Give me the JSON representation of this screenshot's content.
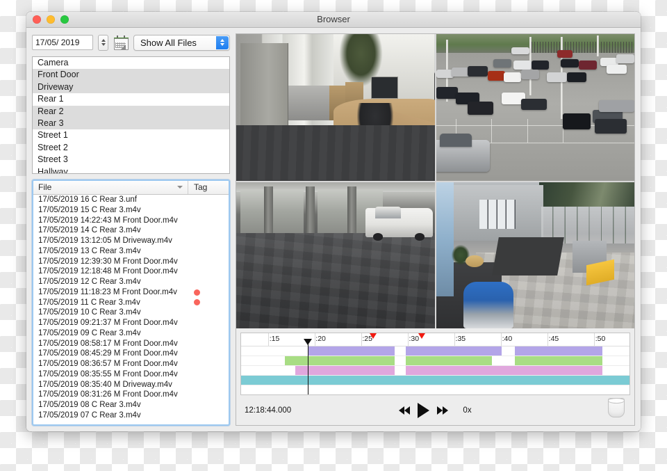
{
  "window": {
    "title": "Browser",
    "traffic_lights": [
      "close",
      "minimize",
      "zoom"
    ]
  },
  "toolbar": {
    "date_value": "17/05/ 2019",
    "calendar_icon": "calendar-icon",
    "stepper_icon": "stepper-updown-icon",
    "filter_selected": "Show All Files",
    "filter_options": [
      "Show All Files"
    ]
  },
  "camera_list": {
    "header": "Camera",
    "items": [
      "Front Door",
      "Driveway",
      "Rear 1",
      "Rear 2",
      "Rear 3",
      "Street 1",
      "Street 2",
      "Street 3",
      "Hallway"
    ]
  },
  "file_list": {
    "columns": {
      "file": "File",
      "tag": "Tag"
    },
    "sort_icon": "chevron-down-icon",
    "rows": [
      {
        "name": "17/05/2019 16 C Rear 3.unf",
        "tag": ""
      },
      {
        "name": "17/05/2019 15 C Rear 3.m4v",
        "tag": ""
      },
      {
        "name": "17/05/2019 14:22:43 M Front Door.m4v",
        "tag": ""
      },
      {
        "name": "17/05/2019 14 C Rear 3.m4v",
        "tag": ""
      },
      {
        "name": "17/05/2019 13:12:05 M Driveway.m4v",
        "tag": ""
      },
      {
        "name": "17/05/2019 13 C Rear 3.m4v",
        "tag": ""
      },
      {
        "name": "17/05/2019 12:39:30 M Front Door.m4v",
        "tag": ""
      },
      {
        "name": "17/05/2019 12:18:48 M Front Door.m4v",
        "tag": ""
      },
      {
        "name": "17/05/2019 12 C Rear 3.m4v",
        "tag": ""
      },
      {
        "name": "17/05/2019 11:18:23 M Front Door.m4v",
        "tag": "red"
      },
      {
        "name": "17/05/2019 11 C Rear 3.m4v",
        "tag": "red"
      },
      {
        "name": "17/05/2019 10 C Rear 3.m4v",
        "tag": ""
      },
      {
        "name": "17/05/2019 09:21:37 M Front Door.m4v",
        "tag": ""
      },
      {
        "name": "17/05/2019 09 C Rear 3.m4v",
        "tag": ""
      },
      {
        "name": "17/05/2019 08:58:17 M Front Door.m4v",
        "tag": ""
      },
      {
        "name": "17/05/2019 08:45:29 M Front Door.m4v",
        "tag": ""
      },
      {
        "name": "17/05/2019 08:36:57 M Front Door.m4v",
        "tag": ""
      },
      {
        "name": "17/05/2019 08:35:55 M Front Door.m4v",
        "tag": ""
      },
      {
        "name": "17/05/2019 08:35:40 M Driveway.m4v",
        "tag": ""
      },
      {
        "name": "17/05/2019 08:31:26 M Front Door.m4v",
        "tag": ""
      },
      {
        "name": "17/05/2019 08 C Rear 3.m4v",
        "tag": ""
      },
      {
        "name": "17/05/2019 07 C Rear 3.m4v",
        "tag": ""
      }
    ],
    "tag_color": "#f9655c"
  },
  "video_grid": {
    "cells": [
      {
        "id": "cell-office",
        "scene": "office interior with glass entry doors, potted plant, desk with monitor, chairs and dark carpet"
      },
      {
        "id": "cell-lot",
        "scene": "aerial view of dealership parking lot full of cars, light poles, grass and fence at rear"
      },
      {
        "id": "cell-bay",
        "scene": "service bay garage with open doors, tiled floor and a white pickup truck"
      },
      {
        "id": "cell-showroom",
        "scene": "dealership showroom with blue car, yellow desk, tiled floor and landscape banner"
      }
    ]
  },
  "timeline": {
    "ruler_labels": [
      ":15",
      ":20",
      ":25",
      ":30",
      ":35",
      ":40",
      ":45",
      ":50"
    ],
    "ruler_positions_pct": [
      7.0,
      18.9,
      30.9,
      42.9,
      54.9,
      66.9,
      78.9,
      90.9
    ],
    "playhead_pct": 17.1,
    "red_markers_pct": [
      34.0,
      46.5
    ],
    "tracks": [
      {
        "name": "track-purple",
        "color": "#b3a5e8",
        "segments": [
          {
            "start_pct": 17.1,
            "end_pct": 39.6
          },
          {
            "start_pct": 42.4,
            "end_pct": 67.0
          },
          {
            "start_pct": 70.4,
            "end_pct": 93.1
          }
        ]
      },
      {
        "name": "track-green",
        "color": "#a8dd84",
        "segments": [
          {
            "start_pct": 11.2,
            "end_pct": 39.6
          },
          {
            "start_pct": 42.4,
            "end_pct": 64.5
          },
          {
            "start_pct": 70.4,
            "end_pct": 93.1
          }
        ]
      },
      {
        "name": "track-pink",
        "color": "#e0a7dd",
        "segments": [
          {
            "start_pct": 13.9,
            "end_pct": 39.6
          },
          {
            "start_pct": 42.4,
            "end_pct": 93.1
          }
        ]
      },
      {
        "name": "track-teal",
        "color": "#7bcbd4",
        "segments": [
          {
            "start_pct": 0.0,
            "end_pct": 100.0
          }
        ]
      },
      {
        "name": "track-empty-1",
        "color": "#ffffff",
        "segments": []
      },
      {
        "name": "track-empty-2",
        "color": "#ffffff",
        "segments": []
      }
    ]
  },
  "transport": {
    "timecode": "12:18:44.000",
    "rewind_icon": "rewind-icon",
    "play_icon": "play-icon",
    "fastforward_icon": "fast-forward-icon",
    "speed": "0x",
    "trash_icon": "trash-icon"
  }
}
